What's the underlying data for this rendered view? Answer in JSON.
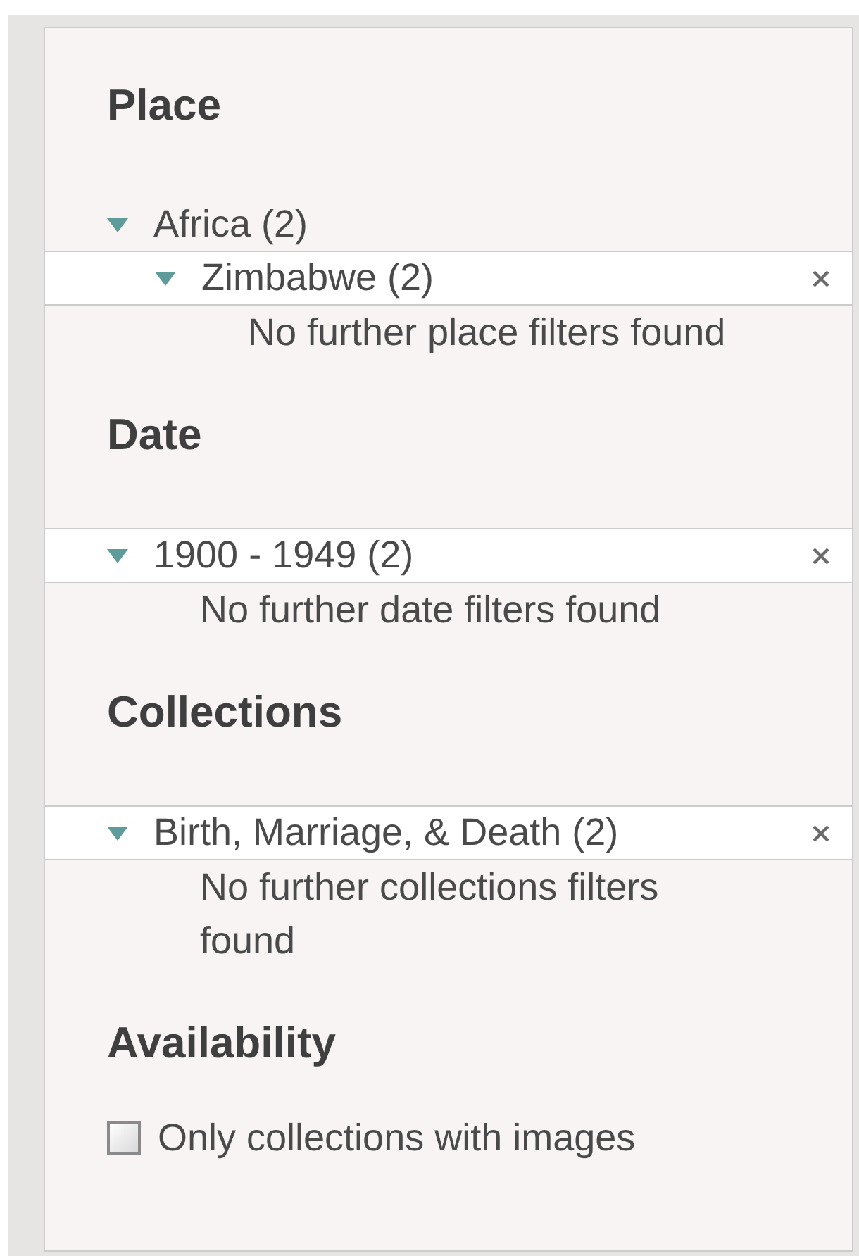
{
  "sections": [
    {
      "kind": "tree",
      "title": "Place",
      "items": [
        {
          "label": "Africa (2)",
          "expanded": true,
          "selected": false,
          "children": [
            {
              "label": "Zimbabwe (2)",
              "expanded": true,
              "selected": true
            }
          ]
        }
      ],
      "note": "No further place filters found"
    },
    {
      "kind": "tree",
      "title": "Date",
      "items": [
        {
          "label": "1900 - 1949 (2)",
          "expanded": true,
          "selected": true
        }
      ],
      "note": "No further date filters found"
    },
    {
      "kind": "tree",
      "title": "Collections",
      "items": [
        {
          "label": "Birth, Marriage, & Death (2)",
          "expanded": true,
          "selected": true
        }
      ],
      "note": "No further collections filters found"
    },
    {
      "kind": "checkbox",
      "title": "Availability",
      "options": [
        {
          "label": "Only collections with images",
          "checked": false
        }
      ]
    }
  ]
}
